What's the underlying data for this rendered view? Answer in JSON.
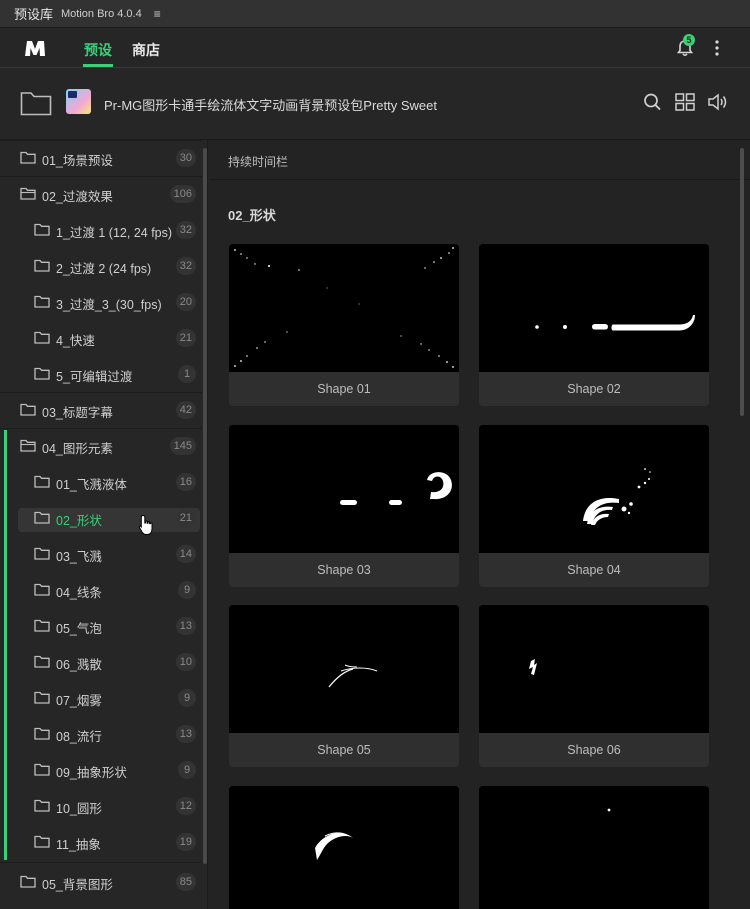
{
  "panel": {
    "title": "预设库",
    "version": "Motion Bro 4.0.4",
    "menu_icon": "≡"
  },
  "header": {
    "logo": "motion-bro-logo",
    "tabs": [
      {
        "label": "预设",
        "active": true
      },
      {
        "label": "商店",
        "active": false
      }
    ],
    "notifications": {
      "icon": "bell-icon",
      "count": "5"
    },
    "more_icon": "vertical-dots-icon",
    "accent_color": "#3ccf7a"
  },
  "pack": {
    "title": "Pr-MG图形卡通手绘流体文字动画背景预设包Pretty Sweet",
    "icons": [
      "search-icon",
      "grid-view-icon",
      "volume-icon"
    ]
  },
  "sidebar": {
    "items": [
      {
        "label": "01_场景预设",
        "count": "30",
        "level": 0
      },
      {
        "label": "02_过渡效果",
        "count": "106",
        "level": 0
      },
      {
        "label": "1_过渡 1 (12, 24 fps)",
        "count": "32",
        "level": 1
      },
      {
        "label": "2_过渡 2 (24 fps)",
        "count": "32",
        "level": 1
      },
      {
        "label": "3_过渡_3_(30_fps)",
        "count": "20",
        "level": 1
      },
      {
        "label": "4_快速",
        "count": "21",
        "level": 1
      },
      {
        "label": "5_可编辑过渡",
        "count": "1",
        "level": 1
      },
      {
        "label": "03_标题字幕",
        "count": "42",
        "level": 0
      },
      {
        "label": "04_图形元素",
        "count": "145",
        "level": 0
      },
      {
        "label": "01_飞溅液体",
        "count": "16",
        "level": 1
      },
      {
        "label": "02_形状",
        "count": "21",
        "level": 1,
        "selected": true
      },
      {
        "label": "03_飞溅",
        "count": "14",
        "level": 1
      },
      {
        "label": "04_线条",
        "count": "9",
        "level": 1
      },
      {
        "label": "05_气泡",
        "count": "13",
        "level": 1
      },
      {
        "label": "06_溅散",
        "count": "10",
        "level": 1
      },
      {
        "label": "07_烟雾",
        "count": "9",
        "level": 1
      },
      {
        "label": "08_流行",
        "count": "13",
        "level": 1
      },
      {
        "label": "09_抽象形状",
        "count": "9",
        "level": 1
      },
      {
        "label": "10_圆形",
        "count": "12",
        "level": 1
      },
      {
        "label": "11_抽象",
        "count": "19",
        "level": 1
      },
      {
        "label": "05_背景图形",
        "count": "85",
        "level": 0
      }
    ]
  },
  "main": {
    "timeline_label": "持续时间栏",
    "section_title": "02_形状",
    "cards": [
      {
        "name": "Shape 01"
      },
      {
        "name": "Shape 02"
      },
      {
        "name": "Shape 03"
      },
      {
        "name": "Shape 04"
      },
      {
        "name": "Shape 05"
      },
      {
        "name": "Shape 06"
      },
      {
        "name": ""
      },
      {
        "name": ""
      }
    ]
  }
}
